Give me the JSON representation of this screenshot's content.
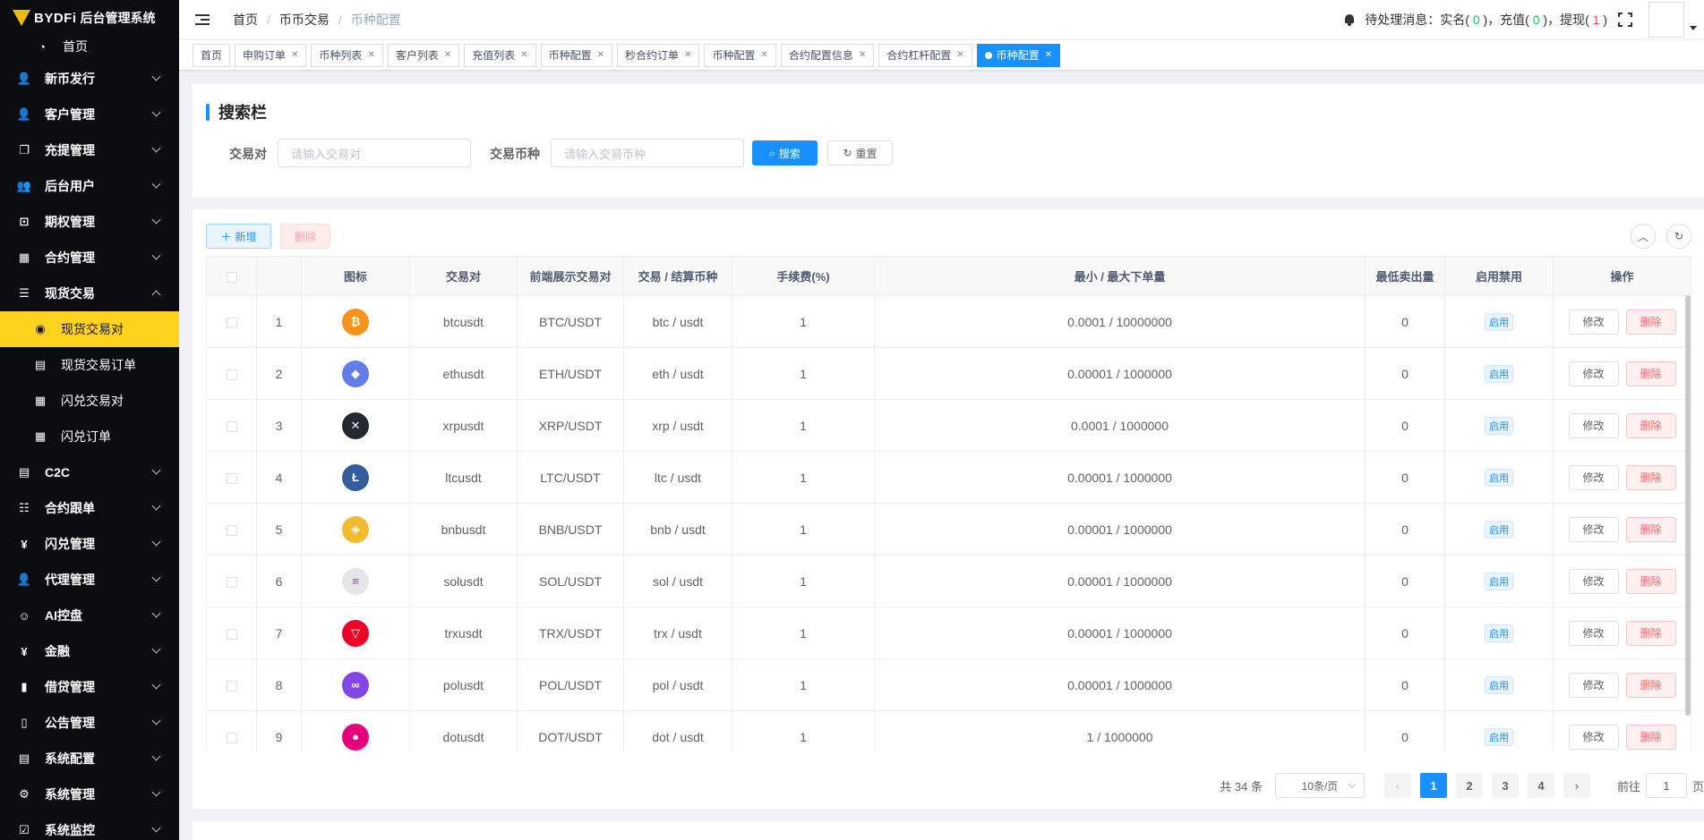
{
  "sidebar": {
    "brand": "BYDFi",
    "brand_sub": "后台管理系统",
    "home": "首页",
    "items": [
      {
        "label": "新币发行",
        "icon": "user-icon",
        "glyph": "👤"
      },
      {
        "label": "客户管理",
        "icon": "user-icon",
        "glyph": "👤"
      },
      {
        "label": "充提管理",
        "icon": "copy-icon",
        "glyph": "❐"
      },
      {
        "label": "后台用户",
        "icon": "peoples-icon",
        "glyph": "👥"
      },
      {
        "label": "期权管理",
        "icon": "monitor-icon",
        "glyph": "⊡"
      },
      {
        "label": "合约管理",
        "icon": "table-icon",
        "glyph": "▦"
      }
    ],
    "expanded": {
      "label": "现货交易",
      "icon": "list-icon",
      "glyph": "☰"
    },
    "subitems": [
      {
        "label": "现货交易对",
        "icon": "coin-icon",
        "glyph": "◉",
        "active": true
      },
      {
        "label": "现货交易订单",
        "icon": "grid-icon",
        "glyph": "▤",
        "active": false
      },
      {
        "label": "闪兑交易对",
        "icon": "table-icon",
        "glyph": "▦",
        "active": false
      },
      {
        "label": "闪兑订单",
        "icon": "table-icon",
        "glyph": "▦",
        "active": false
      }
    ],
    "items2": [
      {
        "label": "C2C",
        "icon": "document-icon",
        "glyph": "▤"
      },
      {
        "label": "合约跟单",
        "icon": "tree-table-icon",
        "glyph": "☷"
      },
      {
        "label": "闪兑管理",
        "icon": "yen-icon",
        "glyph": "¥"
      },
      {
        "label": "代理管理",
        "icon": "user-icon",
        "glyph": "👤"
      },
      {
        "label": "AI控盘",
        "icon": "robot-icon",
        "glyph": "☺"
      },
      {
        "label": "金融",
        "icon": "yen-icon",
        "glyph": "¥"
      },
      {
        "label": "借贷管理",
        "icon": "book-icon",
        "glyph": "▮"
      },
      {
        "label": "公告管理",
        "icon": "book-open-icon",
        "glyph": "▯"
      },
      {
        "label": "系统配置",
        "icon": "document-icon",
        "glyph": "▤"
      },
      {
        "label": "系统管理",
        "icon": "gear-icon",
        "glyph": "⚙"
      },
      {
        "label": "系统监控",
        "icon": "monitor-check-icon",
        "glyph": "☑"
      }
    ]
  },
  "header": {
    "breadcrumb": [
      "首页",
      "币币交易",
      "币种配置"
    ],
    "notice_prefix": "待处理消息：实名(",
    "notice_realname": " 0 ",
    "notice_mid1": ")，充值(",
    "notice_recharge": " 0 ",
    "notice_mid2": ")，提现(",
    "notice_withdraw": " 1 ",
    "notice_suffix": ")"
  },
  "tags": [
    {
      "label": "首页",
      "closable": false,
      "active": false
    },
    {
      "label": "申购订单",
      "closable": true,
      "active": false
    },
    {
      "label": "币种列表",
      "closable": true,
      "active": false
    },
    {
      "label": "客户列表",
      "closable": true,
      "active": false
    },
    {
      "label": "充值列表",
      "closable": true,
      "active": false
    },
    {
      "label": "币种配置",
      "closable": true,
      "active": false
    },
    {
      "label": "秒合约订单",
      "closable": true,
      "active": false
    },
    {
      "label": "币种配置",
      "closable": true,
      "active": false
    },
    {
      "label": "合约配置信息",
      "closable": true,
      "active": false
    },
    {
      "label": "合约杠杆配置",
      "closable": true,
      "active": false
    },
    {
      "label": "币种配置",
      "closable": true,
      "active": true
    }
  ],
  "search": {
    "title": "搜索栏",
    "pair_label": "交易对",
    "pair_placeholder": "请输入交易对",
    "coin_label": "交易币种",
    "coin_placeholder": "请输入交易币种",
    "search_btn": "搜索",
    "reset_btn": "重置"
  },
  "toolbar": {
    "add": "新增",
    "delete": "删除"
  },
  "table": {
    "headers": [
      "",
      "",
      "图标",
      "交易对",
      "前端展示交易对",
      "交易 / 结算币种",
      "手续费(%)",
      "最小 / 最大下单量",
      "最低卖出量",
      "启用禁用",
      "操作"
    ],
    "edit_label": "修改",
    "delete_label": "删除",
    "rows": [
      {
        "no": "1",
        "symbol": "btcusdt",
        "show": "BTC/USDT",
        "coins": "btc / usdt",
        "fee": "1",
        "range": "0.0001 / 10000000",
        "min_sell": "0",
        "status": "启用",
        "coin_icon": "btc-icon",
        "color": "#f7931a",
        "glyph": "₿"
      },
      {
        "no": "2",
        "symbol": "ethusdt",
        "show": "ETH/USDT",
        "coins": "eth / usdt",
        "fee": "1",
        "range": "0.00001 / 1000000",
        "min_sell": "0",
        "status": "启用",
        "coin_icon": "eth-icon",
        "color": "#627eea",
        "glyph": "◆"
      },
      {
        "no": "3",
        "symbol": "xrpusdt",
        "show": "XRP/USDT",
        "coins": "xrp / usdt",
        "fee": "1",
        "range": "0.0001 / 1000000",
        "min_sell": "0",
        "status": "启用",
        "coin_icon": "xrp-icon",
        "color": "#23292f",
        "glyph": "✕"
      },
      {
        "no": "4",
        "symbol": "ltcusdt",
        "show": "LTC/USDT",
        "coins": "ltc / usdt",
        "fee": "1",
        "range": "0.00001 / 1000000",
        "min_sell": "0",
        "status": "启用",
        "coin_icon": "ltc-icon",
        "color": "#345d9d",
        "glyph": "Ł"
      },
      {
        "no": "5",
        "symbol": "bnbusdt",
        "show": "BNB/USDT",
        "coins": "bnb / usdt",
        "fee": "1",
        "range": "0.00001 / 1000000",
        "min_sell": "0",
        "status": "启用",
        "coin_icon": "bnb-icon",
        "color": "#f3ba2f",
        "glyph": "◈"
      },
      {
        "no": "6",
        "symbol": "solusdt",
        "show": "SOL/USDT",
        "coins": "sol / usdt",
        "fee": "1",
        "range": "0.00001 / 1000000",
        "min_sell": "0",
        "status": "启用",
        "coin_icon": "sol-icon",
        "color": "#e6e6ea",
        "glyph": "≡"
      },
      {
        "no": "7",
        "symbol": "trxusdt",
        "show": "TRX/USDT",
        "coins": "trx / usdt",
        "fee": "1",
        "range": "0.00001 / 1000000",
        "min_sell": "0",
        "status": "启用",
        "coin_icon": "trx-icon",
        "color": "#ef0027",
        "glyph": "▽"
      },
      {
        "no": "8",
        "symbol": "polusdt",
        "show": "POL/USDT",
        "coins": "pol / usdt",
        "fee": "1",
        "range": "0.00001 / 1000000",
        "min_sell": "0",
        "status": "启用",
        "coin_icon": "pol-icon",
        "color": "#8247e5",
        "glyph": "∞"
      },
      {
        "no": "9",
        "symbol": "dotusdt",
        "show": "DOT/USDT",
        "coins": "dot / usdt",
        "fee": "1",
        "range": "1 / 1000000",
        "min_sell": "0",
        "status": "启用",
        "coin_icon": "dot-icon",
        "color": "#e6007a",
        "glyph": "●"
      }
    ]
  },
  "pagination": {
    "total": "共 34 条",
    "page_size": "10条/页",
    "pages": [
      "1",
      "2",
      "3",
      "4"
    ],
    "current": "1",
    "goto_prefix": "前往",
    "goto_value": "1",
    "goto_suffix": "页"
  },
  "colors": {
    "primary": "#1890ff",
    "sidebar_bg": "#0b0d10",
    "active_menu": "#ffd21e"
  }
}
